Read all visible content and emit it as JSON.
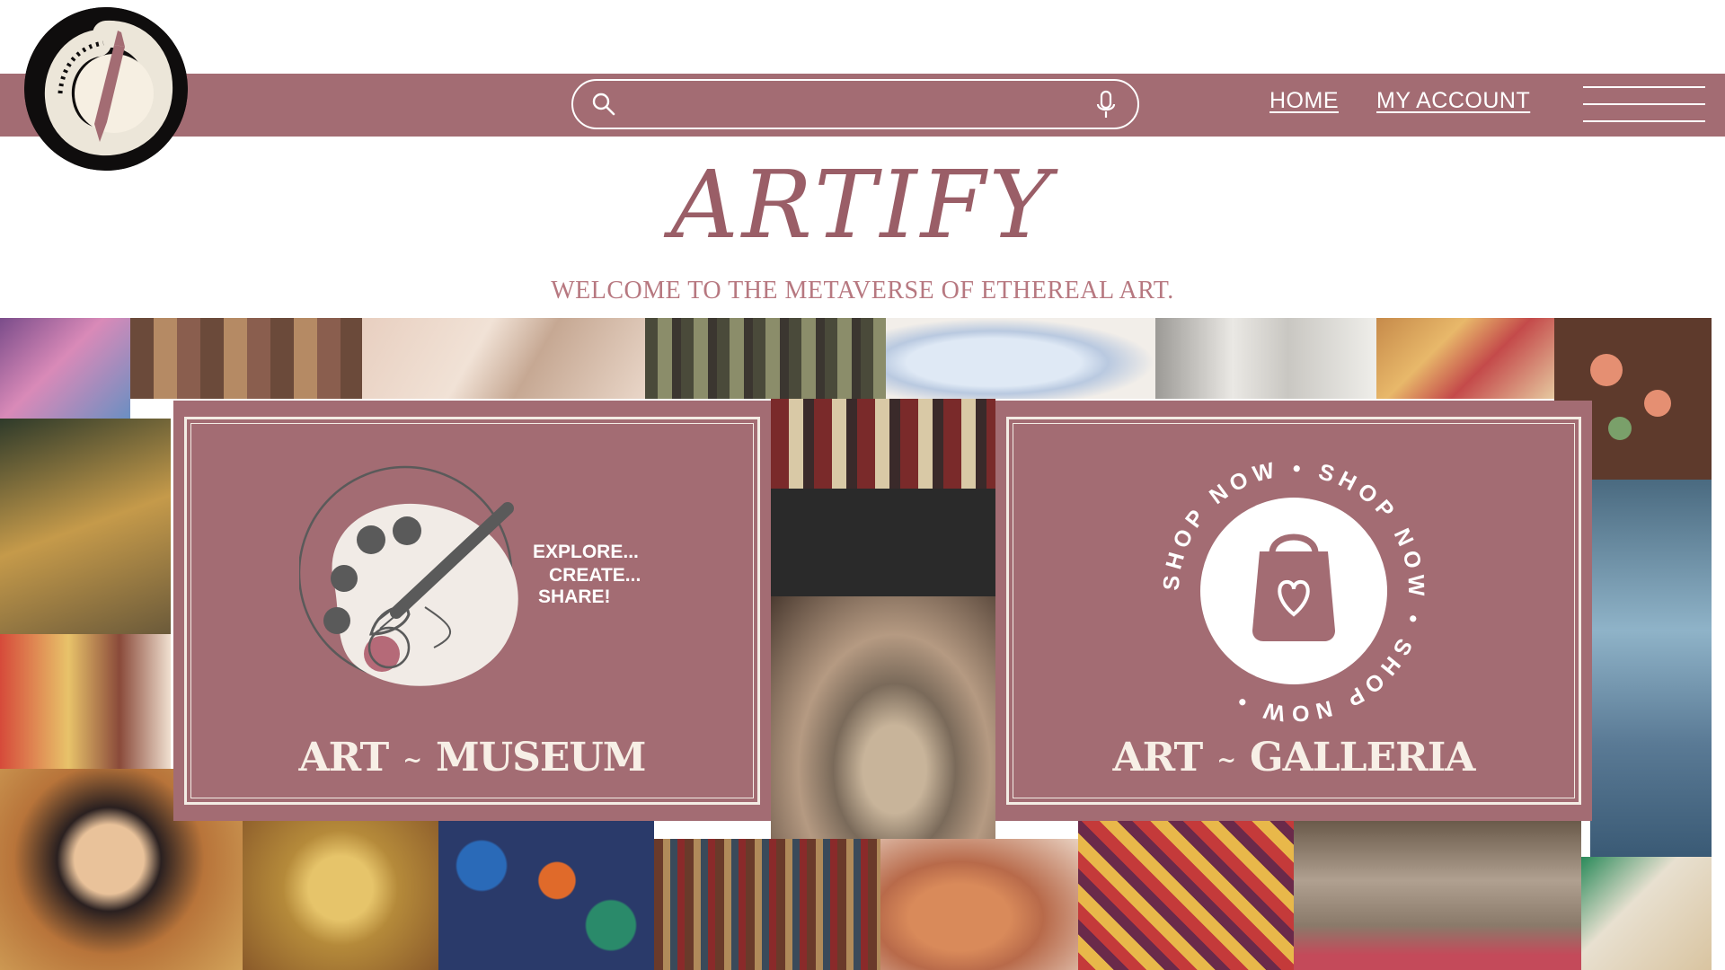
{
  "header": {
    "search": {
      "placeholder": ""
    },
    "nav": {
      "home": "HOME",
      "account": "MY ACCOUNT"
    }
  },
  "hero": {
    "brand": "ARTIFY",
    "tagline": "WELCOME TO THE METAVERSE OF ETHEREAL ART."
  },
  "cards": {
    "museum": {
      "lines": [
        "EXPLORE...",
        "CREATE...",
        "SHARE!"
      ],
      "title_left": "ART",
      "separator": "~",
      "title_right": "MUSEUM"
    },
    "galleria": {
      "badge_text": "SHOP NOW • SHOP NOW • SHOP NOW •",
      "title_left": "ART",
      "separator": "~",
      "title_right": "GALLERIA"
    }
  },
  "colors": {
    "brand_rose": "#a36c73",
    "cream": "#f3ece4",
    "logo_black": "#0f0d0d"
  },
  "icons": [
    "search-icon",
    "microphone-icon",
    "menu-icon",
    "paint-palette-icon",
    "shopping-bag-icon",
    "brush-logo-icon"
  ]
}
